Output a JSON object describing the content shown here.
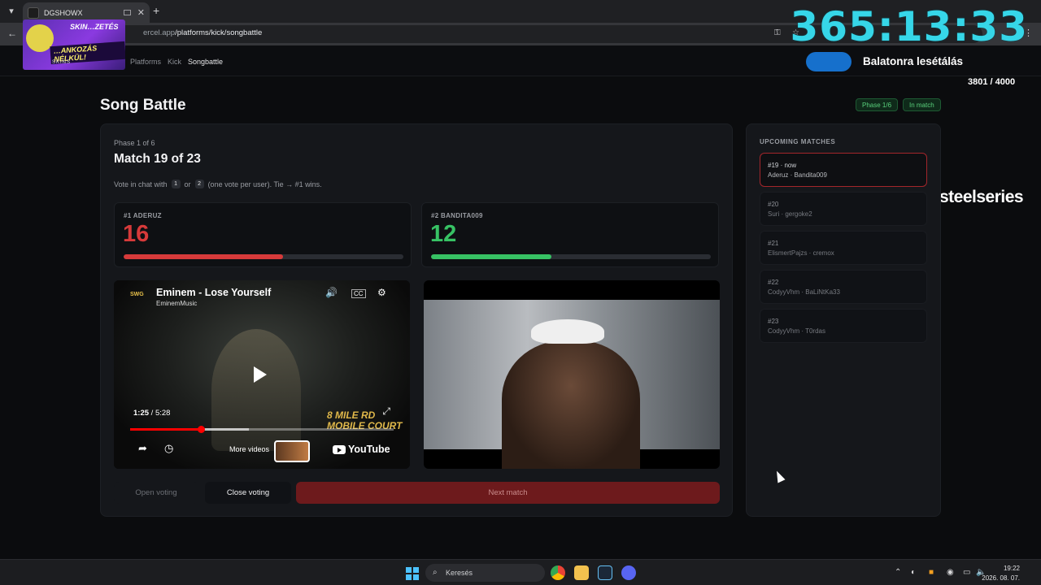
{
  "browser": {
    "tab_title": "DGSHOWX",
    "url_host": "ercel.app",
    "url_path": "/platforms/kick/songbattle"
  },
  "overlay": {
    "promo_line1": "SKIN…ZETÉS",
    "promo_line2": "…ANKOZÁS NÉLKÜL!",
    "promo_brand": "SKINS",
    "timer": "365:13:33",
    "goal_title": "Balatonra lesétálás",
    "goal_count": "3801 / 4000",
    "goal_progress": 0.95,
    "sponsor": "steelseries"
  },
  "breadcrumbs": [
    "Platforms",
    "Kick",
    "Songbattle"
  ],
  "page": {
    "title": "Song Battle",
    "badges": [
      "Phase 1/6",
      "In match"
    ]
  },
  "match": {
    "phase_label": "Phase 1 of 6",
    "title": "Match 19 of 23",
    "vote_prefix": "Vote in chat with",
    "vote_key1": "1",
    "vote_or": "or",
    "vote_key2": "2",
    "vote_suffix": "(one vote per user). Tie → #1 wins."
  },
  "contestants": [
    {
      "label": "#1 ADERUZ",
      "score": "16",
      "share": 0.57,
      "color": "#d63a3a"
    },
    {
      "label": "#2 BANDITA009",
      "score": "12",
      "share": 0.43,
      "color": "#37c264"
    }
  ],
  "video1": {
    "channel_logo": "SWG",
    "title": "Eminem - Lose Yourself",
    "channel": "EminemMusic",
    "time_current": "1:25",
    "time_total": "5:28",
    "progress": 0.27,
    "buffered": 0.45,
    "more_videos": "More videos",
    "brand": "YouTube",
    "overlay_text": "8 MILE RD MOBILE COURT"
  },
  "buttons": {
    "open_voting": "Open voting",
    "close_voting": "Close voting",
    "next_match": "Next match"
  },
  "upcoming": {
    "title": "UPCOMING MATCHES",
    "items": [
      {
        "num": "#19 · now",
        "names": "Aderuz · Bandita009",
        "current": true
      },
      {
        "num": "#20",
        "names": "Suri · gergoke2",
        "current": false
      },
      {
        "num": "#21",
        "names": "ElismertPajzs · cremox",
        "current": false
      },
      {
        "num": "#22",
        "names": "CodyyVhm · BaLiNtKa33",
        "current": false
      },
      {
        "num": "#23",
        "names": "CodyyVhm · T0rdas",
        "current": false
      }
    ]
  },
  "taskbar": {
    "search_placeholder": "Keresés",
    "time": "19:22",
    "date": "2026. 08. 07."
  },
  "colors": {
    "accent_red": "#d63a3a",
    "accent_green": "#37c264",
    "timer_cyan": "#36d6e8"
  }
}
